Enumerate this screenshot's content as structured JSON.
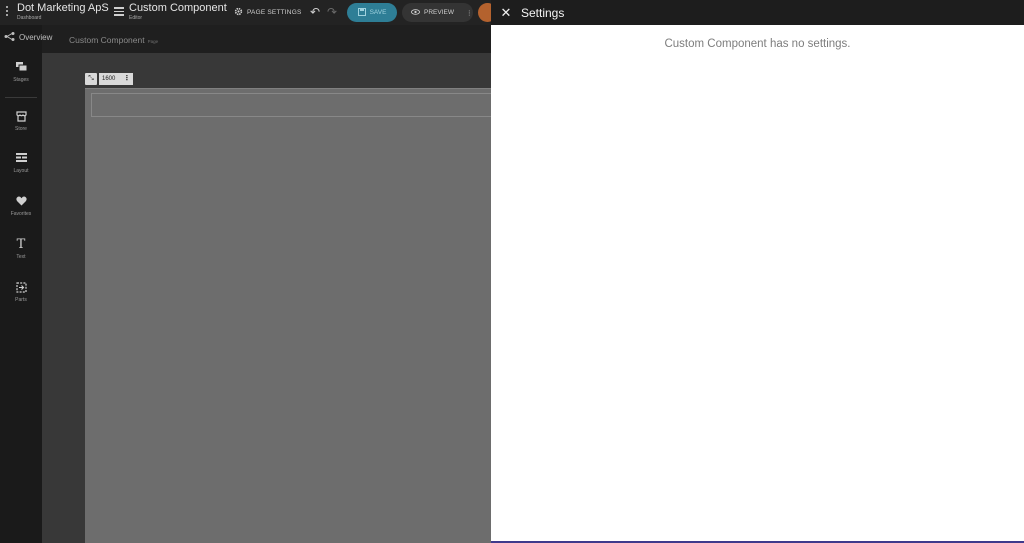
{
  "topbar": {
    "company": "Dot Marketing ApS",
    "company_sub": "Dashboard",
    "component": "Custom Component",
    "component_sub": "Editor",
    "page_settings": "PAGE SETTINGS",
    "save": "SAVE",
    "preview": "PREVIEW"
  },
  "overview": "Overview",
  "breadcrumb": {
    "name": "Custom Component",
    "type": "Page"
  },
  "sidebar": {
    "items": [
      {
        "label": "Stages",
        "icon": "stages-icon"
      },
      {
        "label": "Store",
        "icon": "store-icon"
      },
      {
        "label": "Layout",
        "icon": "layout-icon"
      },
      {
        "label": "Favorites",
        "icon": "heart-icon"
      },
      {
        "label": "Text",
        "icon": "text-icon"
      },
      {
        "label": "Parts",
        "icon": "parts-icon"
      }
    ]
  },
  "canvas": {
    "width_value": "1600"
  },
  "panel": {
    "title": "Settings",
    "message": "Custom Component has no settings."
  },
  "colors": {
    "save_bg": "#2e7e96",
    "avatar": "#b4622e",
    "panel_bg": "#ffffff"
  }
}
